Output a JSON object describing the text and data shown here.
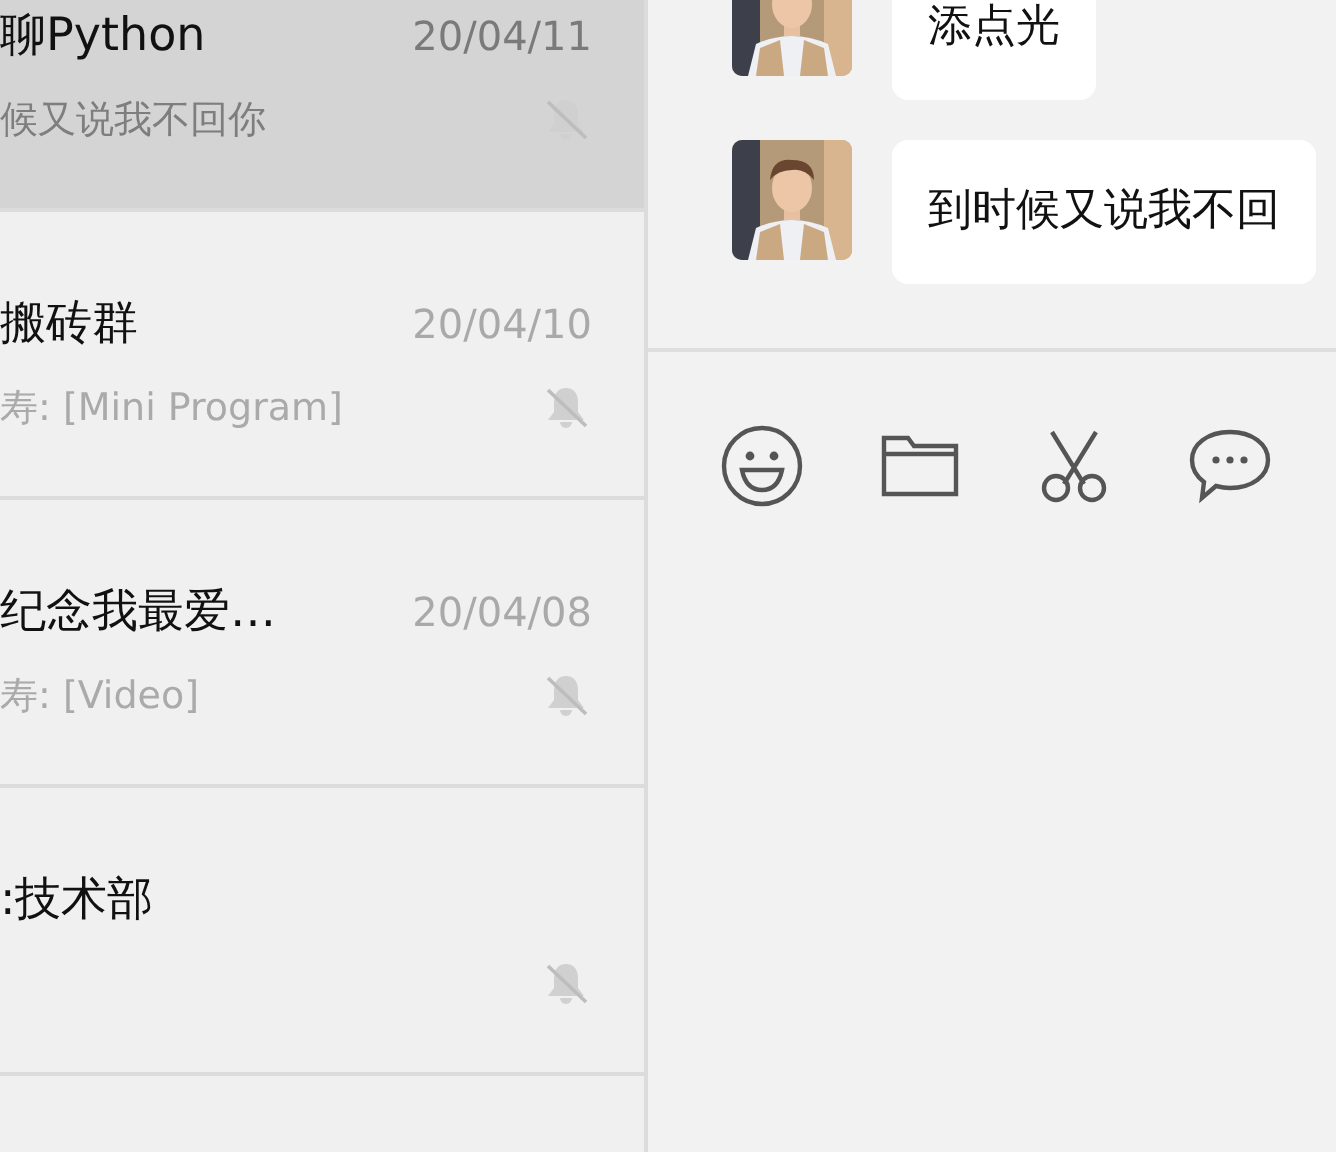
{
  "chats": [
    {
      "name": "聊Python",
      "date": "20/04/11",
      "preview": "候又说我不回你",
      "muted": true,
      "selected": true
    },
    {
      "name": "搬砖群",
      "date": "20/04/10",
      "preview": "寿: [Mini Program]",
      "muted": true,
      "selected": false
    },
    {
      "name": "纪念我最爱…",
      "date": "20/04/08",
      "preview": "寿: [Video]",
      "muted": true,
      "selected": false
    },
    {
      "name": ":技术部",
      "muted": true,
      "selected": false
    }
  ],
  "messages": [
    {
      "text": "添点光"
    },
    {
      "text": "到时候又说我不回"
    }
  ],
  "toolbar": [
    {
      "kind": "emoji"
    },
    {
      "kind": "folder"
    },
    {
      "kind": "scissors"
    },
    {
      "kind": "chat"
    }
  ]
}
